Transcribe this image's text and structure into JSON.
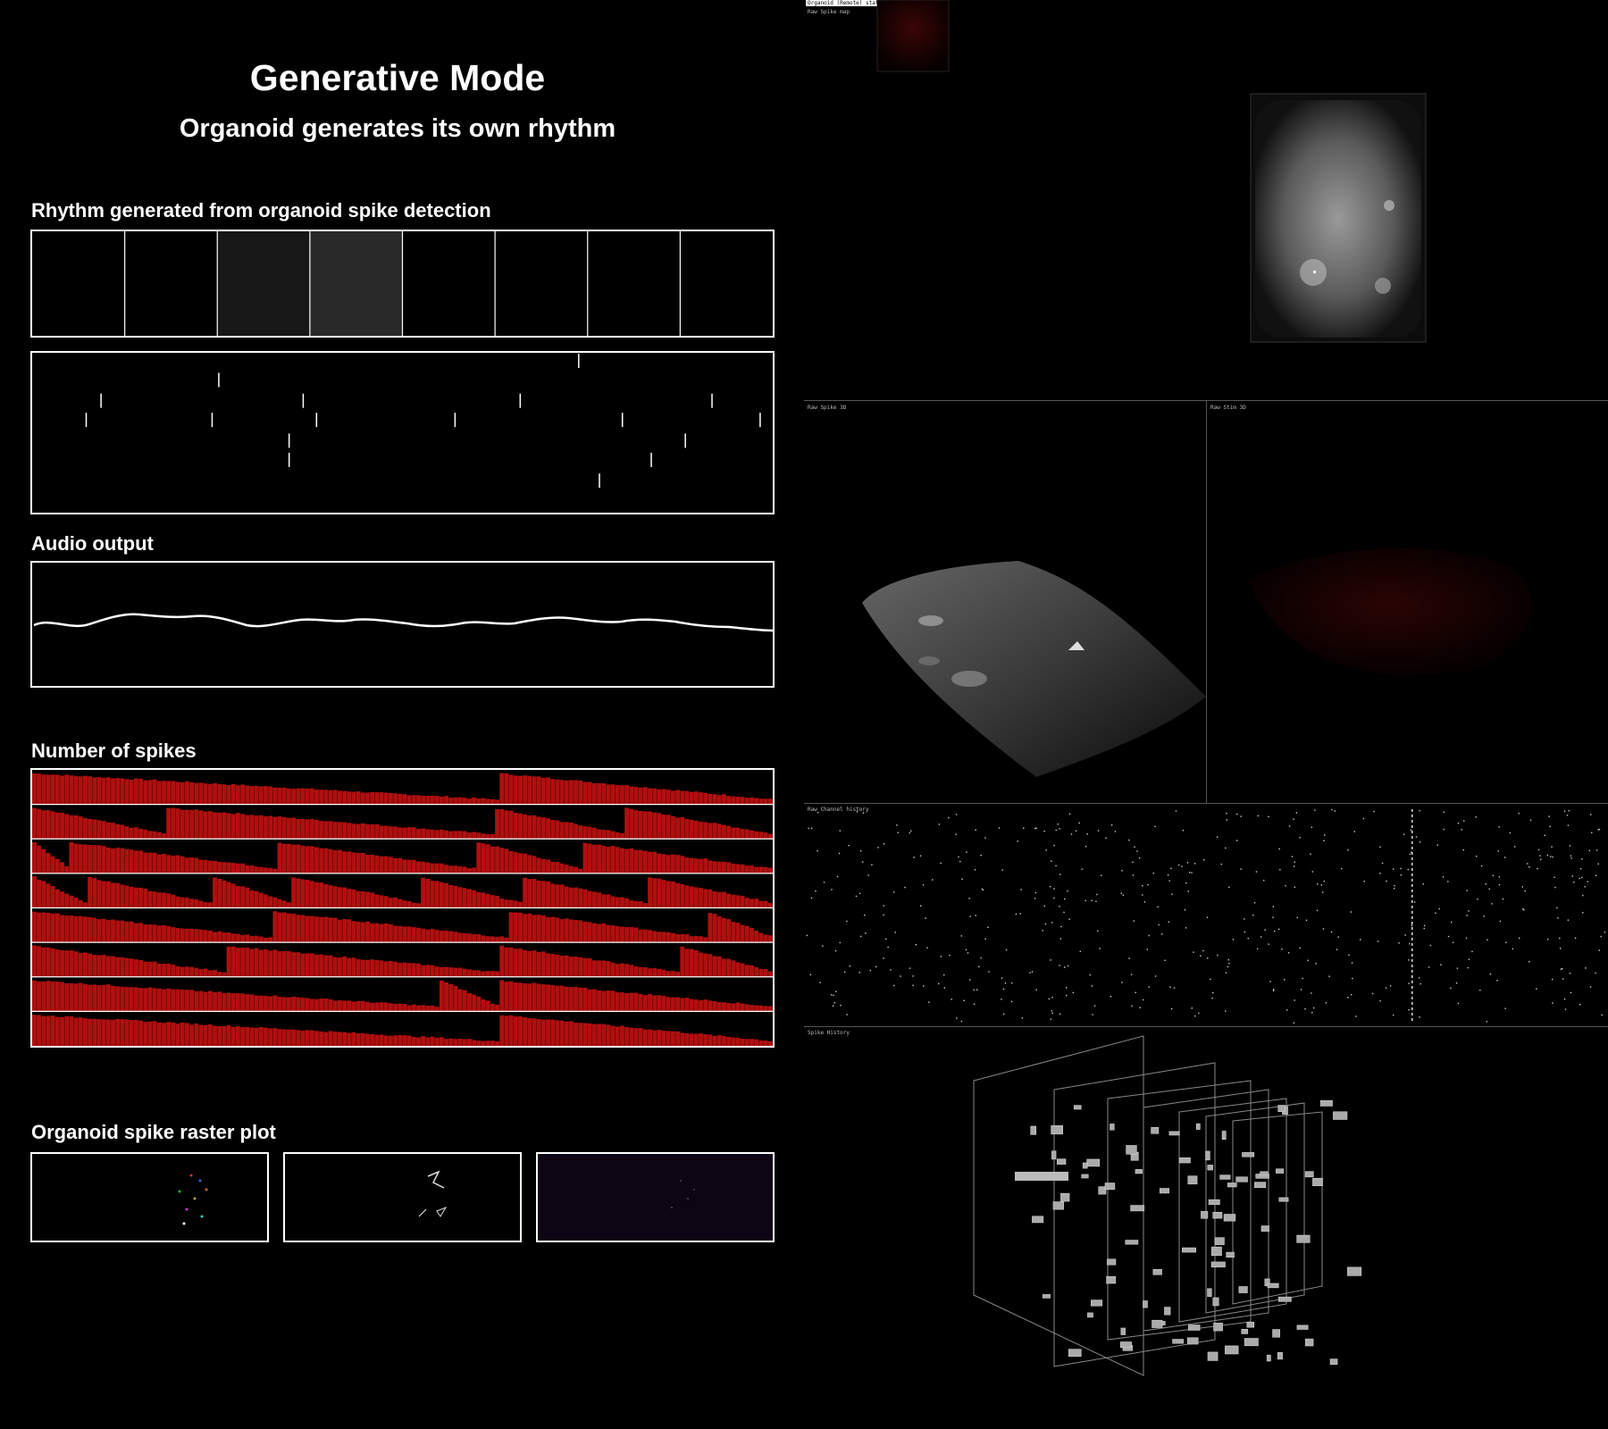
{
  "header": {
    "title": "Generative Mode",
    "subtitle": "Organoid generates its own rhythm"
  },
  "sections": {
    "rhythm_label": "Rhythm generated from organoid spike detection",
    "audio_label": "Audio output",
    "spikes_label": "Number of spikes",
    "raster_label": "Organoid spike raster plot"
  },
  "right_panels": {
    "status_tag": "Organoid (Remote) status",
    "spike_map": "Raw Spike map",
    "spike_3d": "Raw Spike 3D",
    "stim_3d": "Raw Stim 3D",
    "channel_history": "Raw Channel history",
    "spike_history": "Spike History"
  },
  "colors": {
    "spike_red": "#b00f0f",
    "panel_border": "#ffffff",
    "divider": "#555555"
  },
  "rhythm_steps": {
    "count": 8,
    "levels": [
      0,
      0,
      0.09,
      0.16,
      0,
      0,
      0,
      0
    ]
  },
  "spike_events": [
    {
      "t": 0.073,
      "y": 0.42
    },
    {
      "t": 0.093,
      "y": 0.3
    },
    {
      "t": 0.252,
      "y": 0.17
    },
    {
      "t": 0.243,
      "y": 0.42
    },
    {
      "t": 0.366,
      "y": 0.3
    },
    {
      "t": 0.384,
      "y": 0.42
    },
    {
      "t": 0.347,
      "y": 0.55
    },
    {
      "t": 0.347,
      "y": 0.67
    },
    {
      "t": 0.571,
      "y": 0.42
    },
    {
      "t": 0.659,
      "y": 0.3
    },
    {
      "t": 0.738,
      "y": 0.05
    },
    {
      "t": 0.797,
      "y": 0.42
    },
    {
      "t": 0.766,
      "y": 0.8
    },
    {
      "t": 0.836,
      "y": 0.67
    },
    {
      "t": 0.882,
      "y": 0.55
    },
    {
      "t": 0.918,
      "y": 0.3
    },
    {
      "t": 0.983,
      "y": 0.42
    }
  ]
}
